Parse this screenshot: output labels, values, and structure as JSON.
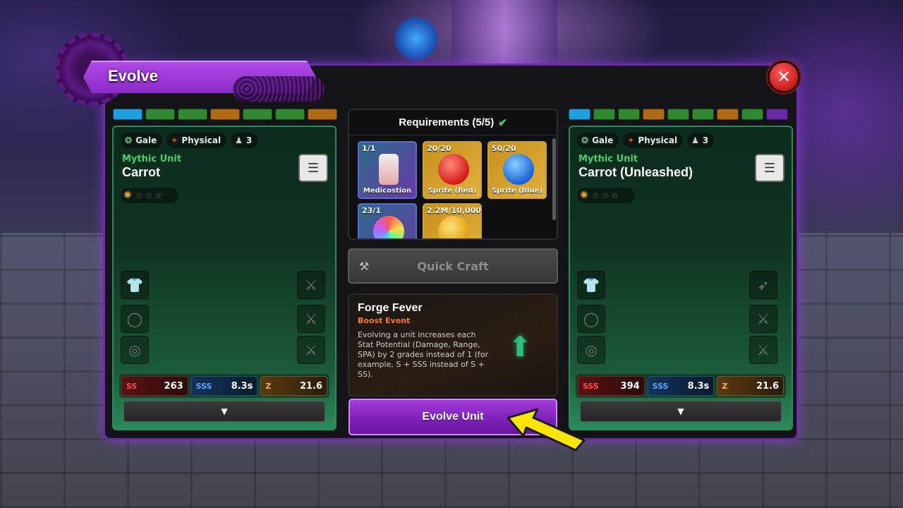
{
  "window": {
    "title": "Evolve",
    "close_icon": "close-icon"
  },
  "colors": {
    "accent": "#8a2cc8",
    "mythic": "#41d16d",
    "boost": "#ff7a1a",
    "check": "#3fd46b"
  },
  "left_bars": [
    "#1e9fe0",
    "#2f8a2f",
    "#2f8a2f",
    "#b06a14",
    "#2f8a2f",
    "#2f8a2f",
    "#b06a14"
  ],
  "right_bars": [
    "#1e9fe0",
    "#2f8a2f",
    "#2f8a2f",
    "#b06a14",
    "#2f8a2f",
    "#2f8a2f",
    "#b06a14",
    "#2f8a2f",
    "#6a2aa8"
  ],
  "left_unit": {
    "tags": [
      {
        "icon": "gale-icon",
        "label": "Gale"
      },
      {
        "icon": "physical-icon",
        "label": "Physical"
      },
      {
        "icon": "placement-icon",
        "label": "3"
      }
    ],
    "rarity": "Mythic Unit",
    "name": "Carrot",
    "stars": 0,
    "stats": [
      {
        "grade": "SS",
        "value": "263",
        "icon": "damage-icon"
      },
      {
        "grade": "SSS",
        "value": "8.3s",
        "icon": "spa-icon"
      },
      {
        "grade": "Z",
        "value": "21.6",
        "icon": "range-icon"
      }
    ]
  },
  "right_unit": {
    "tags": [
      {
        "icon": "gale-icon",
        "label": "Gale"
      },
      {
        "icon": "physical-icon",
        "label": "Physical"
      },
      {
        "icon": "placement-icon",
        "label": "3"
      }
    ],
    "rarity": "Mythic Unit",
    "name": "Carrot (Unleashed)",
    "stars": 0,
    "stats": [
      {
        "grade": "SSS",
        "value": "394",
        "icon": "damage-icon"
      },
      {
        "grade": "SSS",
        "value": "8.3s",
        "icon": "spa-icon"
      },
      {
        "grade": "Z",
        "value": "21.6",
        "icon": "range-icon"
      }
    ]
  },
  "requirements": {
    "title": "Requirements (5/5)",
    "items": [
      {
        "count": "1/1",
        "name": "Medicostion"
      },
      {
        "count": "20/20",
        "name": "Sprite (Red)"
      },
      {
        "count": "50/20",
        "name": "Sprite (Blue)"
      },
      {
        "count": "23/1",
        "name": ""
      },
      {
        "count": "2.2M/10,000",
        "name": ""
      }
    ]
  },
  "quick_craft": {
    "label": "Quick Craft"
  },
  "event": {
    "title": "Forge Fever",
    "subtitle": "Boost Event",
    "description": "Evolving a unit increases each Stat Potential (Damage, Range, SPA) by 2 grades instead of 1 (for example, S + SSS instead of S + SS)."
  },
  "evolve_button": {
    "label": "Evolve Unit"
  }
}
